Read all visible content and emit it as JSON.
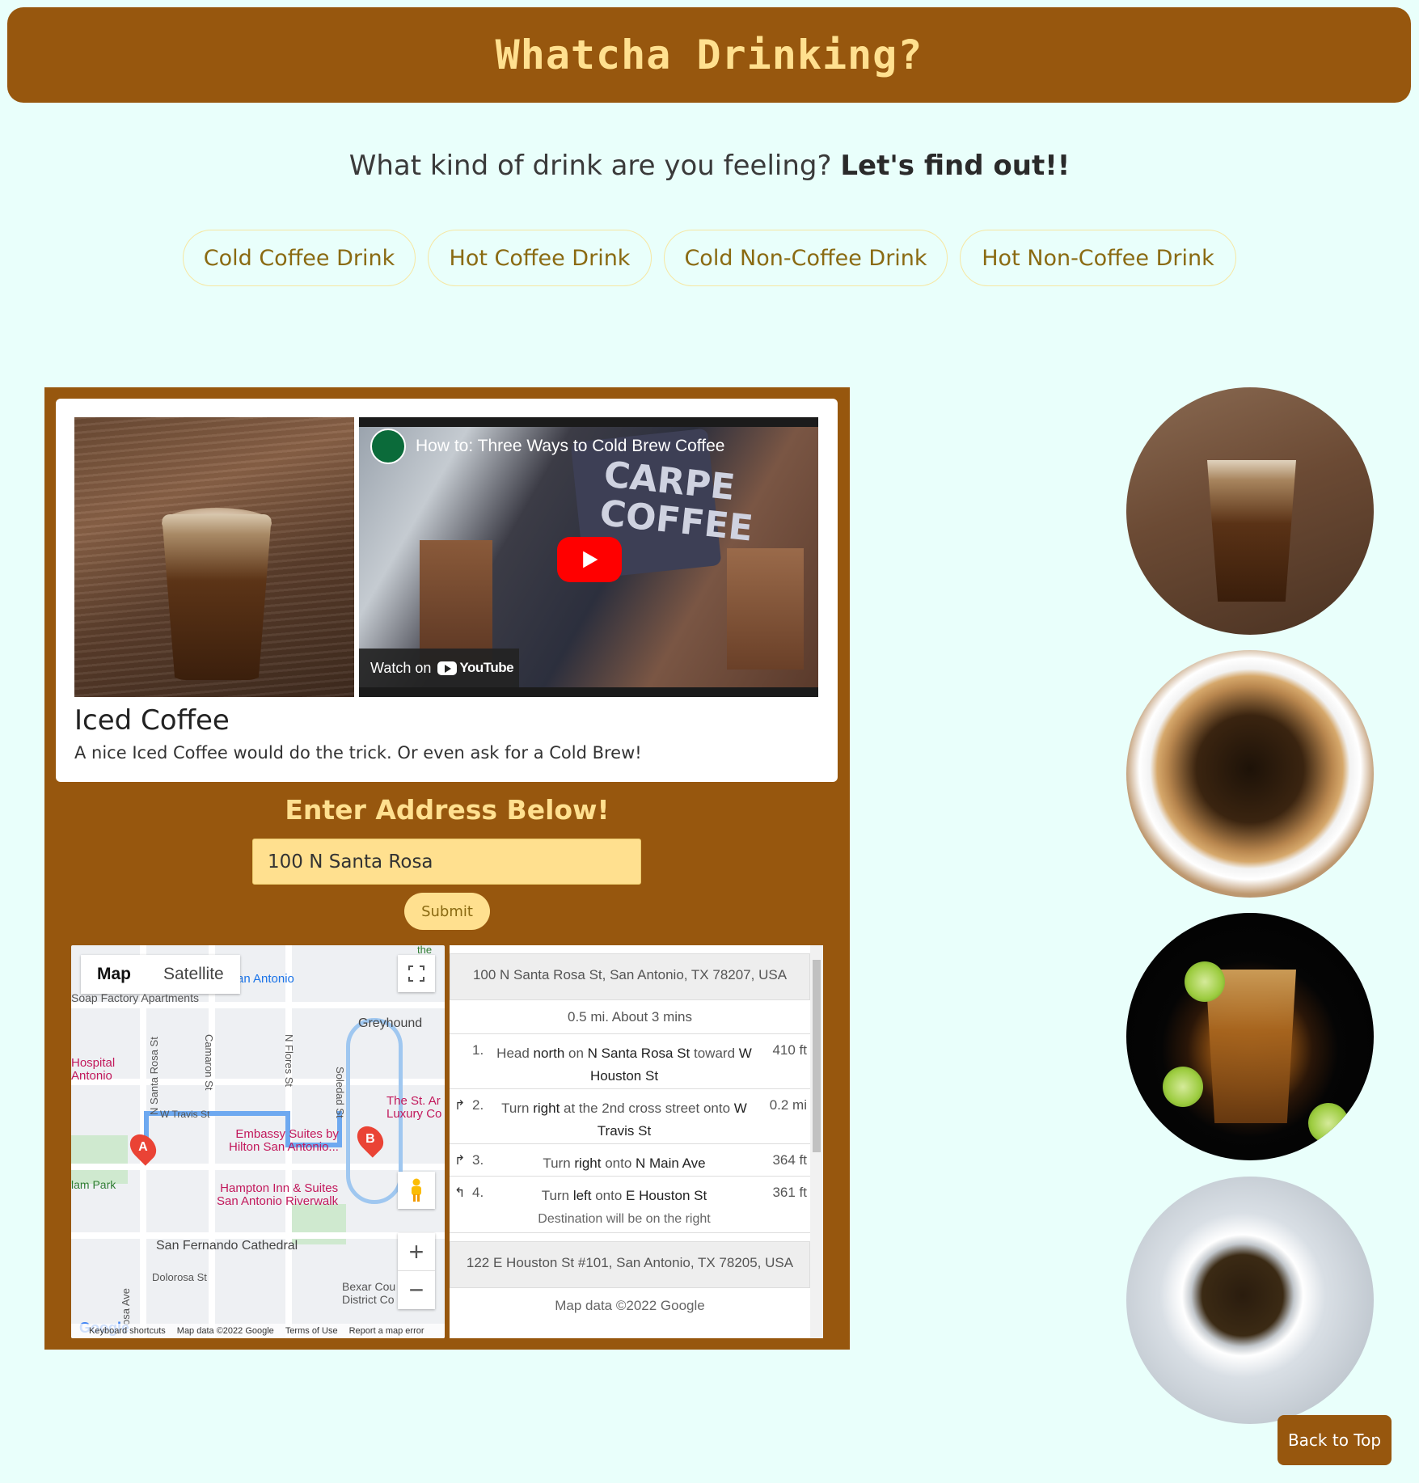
{
  "header": {
    "title": "Whatcha Drinking?"
  },
  "tagline": {
    "text": "What kind of drink are you feeling?",
    "emphasis": "Let's find out!!"
  },
  "choices": [
    "Cold Coffee Drink",
    "Hot Coffee Drink",
    "Cold Non-Coffee Drink",
    "Hot Non-Coffee Drink"
  ],
  "card": {
    "title": "Iced Coffee",
    "text": "A nice Iced Coffee would do the trick. Or even ask for a Cold Brew!",
    "video": {
      "title": "How to: Three Ways to Cold Brew Coffee",
      "shirt_text": "CARPE\nCOFFEE",
      "watch_on": "Watch on",
      "youtube": "YouTube"
    }
  },
  "address": {
    "heading": "Enter Address Below!",
    "value": "100 N Santa Rosa",
    "submit": "Submit"
  },
  "map": {
    "tabs": [
      "Map",
      "Satellite"
    ],
    "labels": {
      "san_antonio": "an Antonio",
      "soap_factory": "Soap Factory Apartments",
      "greyhound": "Greyhound",
      "hospital": "Hospital\nAntonio",
      "santa_rosa": "N Santa Rosa St",
      "camaron": "Camaron St",
      "flores": "N Flores St",
      "soledad": "Soledad St",
      "travis": "W Travis St",
      "st_anthony": "The St. Ar\nLuxury Co",
      "embassy": "Embassy Suites by\nHilton San Antonio...",
      "hampton": "Hampton Inn & Suites\nSan Antonio Riverwalk",
      "milam": "lam Park",
      "cathedral": "San Fernando Cathedral",
      "dolorosa": "Dolorosa St",
      "bexar": "Bexar Cou\nDistrict Co",
      "sa_ave": "osa Ave",
      "the_top": "the"
    },
    "marker_a": "A",
    "marker_b": "B",
    "footer": [
      "Keyboard shortcuts",
      "Map data ©2022 Google",
      "Terms of Use",
      "Report a map error"
    ],
    "google": "Google"
  },
  "directions": {
    "start": "100 N Santa Rosa St, San Antonio, TX 78207, USA",
    "summary": "0.5 mi. About 3 mins",
    "steps": [
      {
        "num": "1.",
        "pre": "Head ",
        "b1": "north",
        "mid": " on ",
        "b2": "N Santa Rosa St",
        "post": " toward ",
        "b3": "W Houston St",
        "dist": "410 ft"
      },
      {
        "num": "2.",
        "pre": "Turn ",
        "b1": "right",
        "mid": " at the 2nd cross street onto ",
        "b2": "W Travis St",
        "dist": "0.2 mi"
      },
      {
        "num": "3.",
        "pre": "Turn ",
        "b1": "right",
        "mid": " onto ",
        "b2": "N Main Ave",
        "dist": "364 ft"
      },
      {
        "num": "4.",
        "pre": "Turn ",
        "b1": "left",
        "mid": " onto ",
        "b2": "E Houston St",
        "sub": "Destination will be on the right",
        "dist": "361 ft"
      }
    ],
    "end": "122 E Houston St #101, San Antonio, TX 78205, USA",
    "copyright": "Map data ©2022 Google"
  },
  "back_to_top": "Back to Top",
  "colors": {
    "brown": "#97570e",
    "cream": "#ffe08f",
    "background": "#e9fffb"
  }
}
